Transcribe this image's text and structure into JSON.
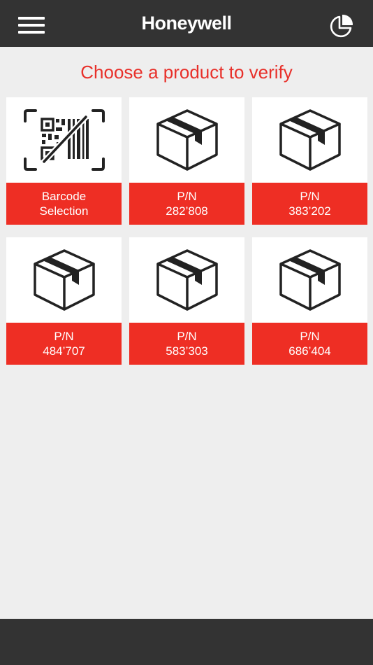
{
  "header": {
    "brand": "Honeywell",
    "menu_icon": "hamburger-menu-icon",
    "chart_icon": "pie-chart-icon",
    "background": "#333333"
  },
  "main": {
    "title": "Choose a product to verify",
    "title_color": "#e8302a",
    "accent": "#ee2e24",
    "tiles": [
      {
        "icon": "barcode-scan-icon",
        "line1": "Barcode",
        "line2": "Selection"
      },
      {
        "icon": "box-icon",
        "line1": "P/N",
        "line2": "282’808"
      },
      {
        "icon": "box-icon",
        "line1": "P/N",
        "line2": "383’202"
      },
      {
        "icon": "box-icon",
        "line1": "P/N",
        "line2": "484’707"
      },
      {
        "icon": "box-icon",
        "line1": "P/N",
        "line2": "583’303"
      },
      {
        "icon": "box-icon",
        "line1": "P/N",
        "line2": "686’404"
      }
    ]
  }
}
